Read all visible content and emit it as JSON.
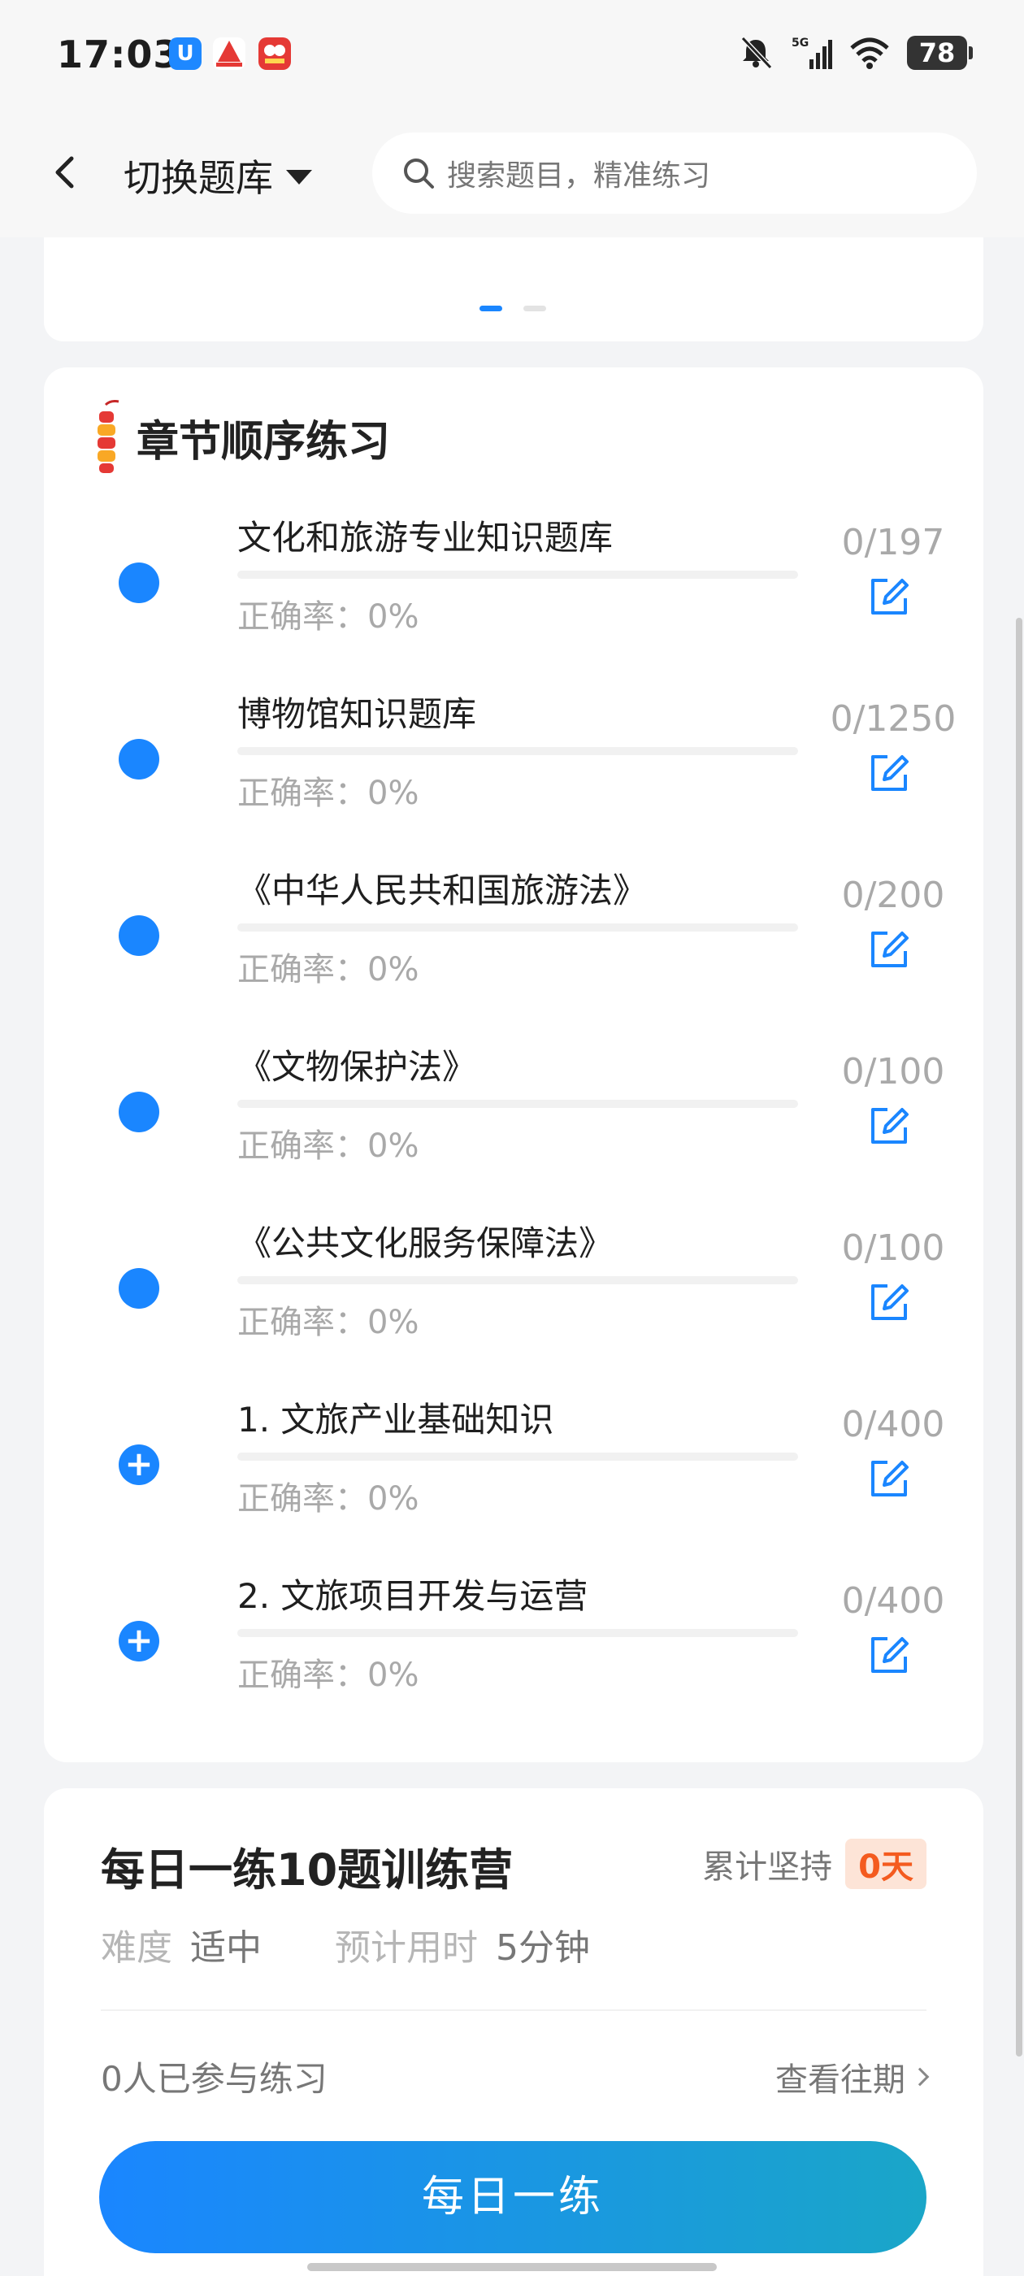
{
  "status_bar": {
    "time": "17:03",
    "battery": "78",
    "network": "5G",
    "icons": [
      "bell-off-icon",
      "signal-icon",
      "wifi-icon",
      "battery-icon"
    ]
  },
  "header": {
    "switch_label": "切换题库",
    "search_placeholder": "搜索题目，精准练习"
  },
  "chapter_section": {
    "title": "章节顺序练习",
    "items": [
      {
        "name": "文化和旅游专业知识题库",
        "accuracy": "正确率：0%",
        "count": "0/197",
        "marker": "dot",
        "progress": 0
      },
      {
        "name": "博物馆知识题库",
        "accuracy": "正确率：0%",
        "count": "0/1250",
        "marker": "dot",
        "progress": 0
      },
      {
        "name": "《中华人民共和国旅游法》",
        "accuracy": "正确率：0%",
        "count": "0/200",
        "marker": "dot",
        "progress": 0
      },
      {
        "name": "《文物保护法》",
        "accuracy": "正确率：0%",
        "count": "0/100",
        "marker": "dot",
        "progress": 0
      },
      {
        "name": "《公共文化服务保障法》",
        "accuracy": "正确率：0%",
        "count": "0/100",
        "marker": "dot",
        "progress": 0
      },
      {
        "name": "1. 文旅产业基础知识",
        "accuracy": "正确率：0%",
        "count": "0/400",
        "marker": "plus",
        "progress": 0
      },
      {
        "name": "2. 文旅项目开发与运营",
        "accuracy": "正确率：0%",
        "count": "0/400",
        "marker": "plus",
        "progress": 0
      }
    ]
  },
  "daily": {
    "title": "每日一练10题训练营",
    "persist_label": "累计坚持",
    "persist_days": "0天",
    "difficulty_label": "难度",
    "difficulty_value": "适中",
    "time_label": "预计用时",
    "time_value": "5分钟",
    "joined": "0人已参与练习",
    "history_link": "查看往期",
    "button": "每日一练"
  },
  "colors": {
    "accent": "#1a86ff",
    "badge_text": "#f45b1f",
    "badge_bg": "#fde4d7"
  }
}
